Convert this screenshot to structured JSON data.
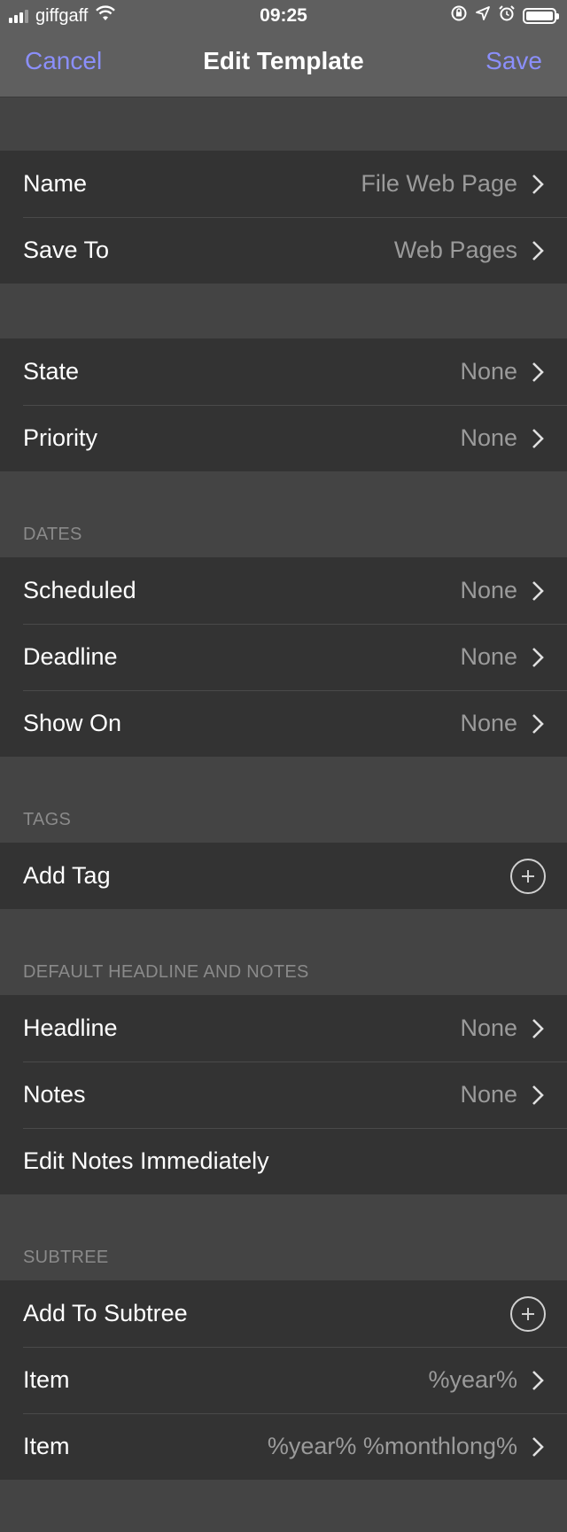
{
  "status_bar": {
    "carrier": "giffgaff",
    "time": "09:25"
  },
  "nav": {
    "cancel_label": "Cancel",
    "title": "Edit Template",
    "save_label": "Save"
  },
  "groups": {
    "general": [
      {
        "label": "Name",
        "value": "File Web Page"
      },
      {
        "label": "Save To",
        "value": "Web Pages"
      }
    ],
    "state": [
      {
        "label": "State",
        "value": "None"
      },
      {
        "label": "Priority",
        "value": "None"
      }
    ],
    "dates_header": "DATES",
    "dates": [
      {
        "label": "Scheduled",
        "value": "None"
      },
      {
        "label": "Deadline",
        "value": "None"
      },
      {
        "label": "Show On",
        "value": "None"
      }
    ],
    "tags_header": "TAGS",
    "tags": {
      "add_label": "Add Tag"
    },
    "headline_header": "DEFAULT HEADLINE AND NOTES",
    "headline": [
      {
        "label": "Headline",
        "value": "None"
      },
      {
        "label": "Notes",
        "value": "None"
      }
    ],
    "edit_notes_label": "Edit Notes Immediately",
    "subtree_header": "SUBTREE",
    "subtree": {
      "add_label": "Add To Subtree",
      "items": [
        {
          "label": "Item",
          "value": "%year%"
        },
        {
          "label": "Item",
          "value": "%year% %monthlong%"
        }
      ]
    }
  },
  "colors": {
    "accent": "#8b8ffb",
    "background": "#444444",
    "cell": "#333333"
  }
}
